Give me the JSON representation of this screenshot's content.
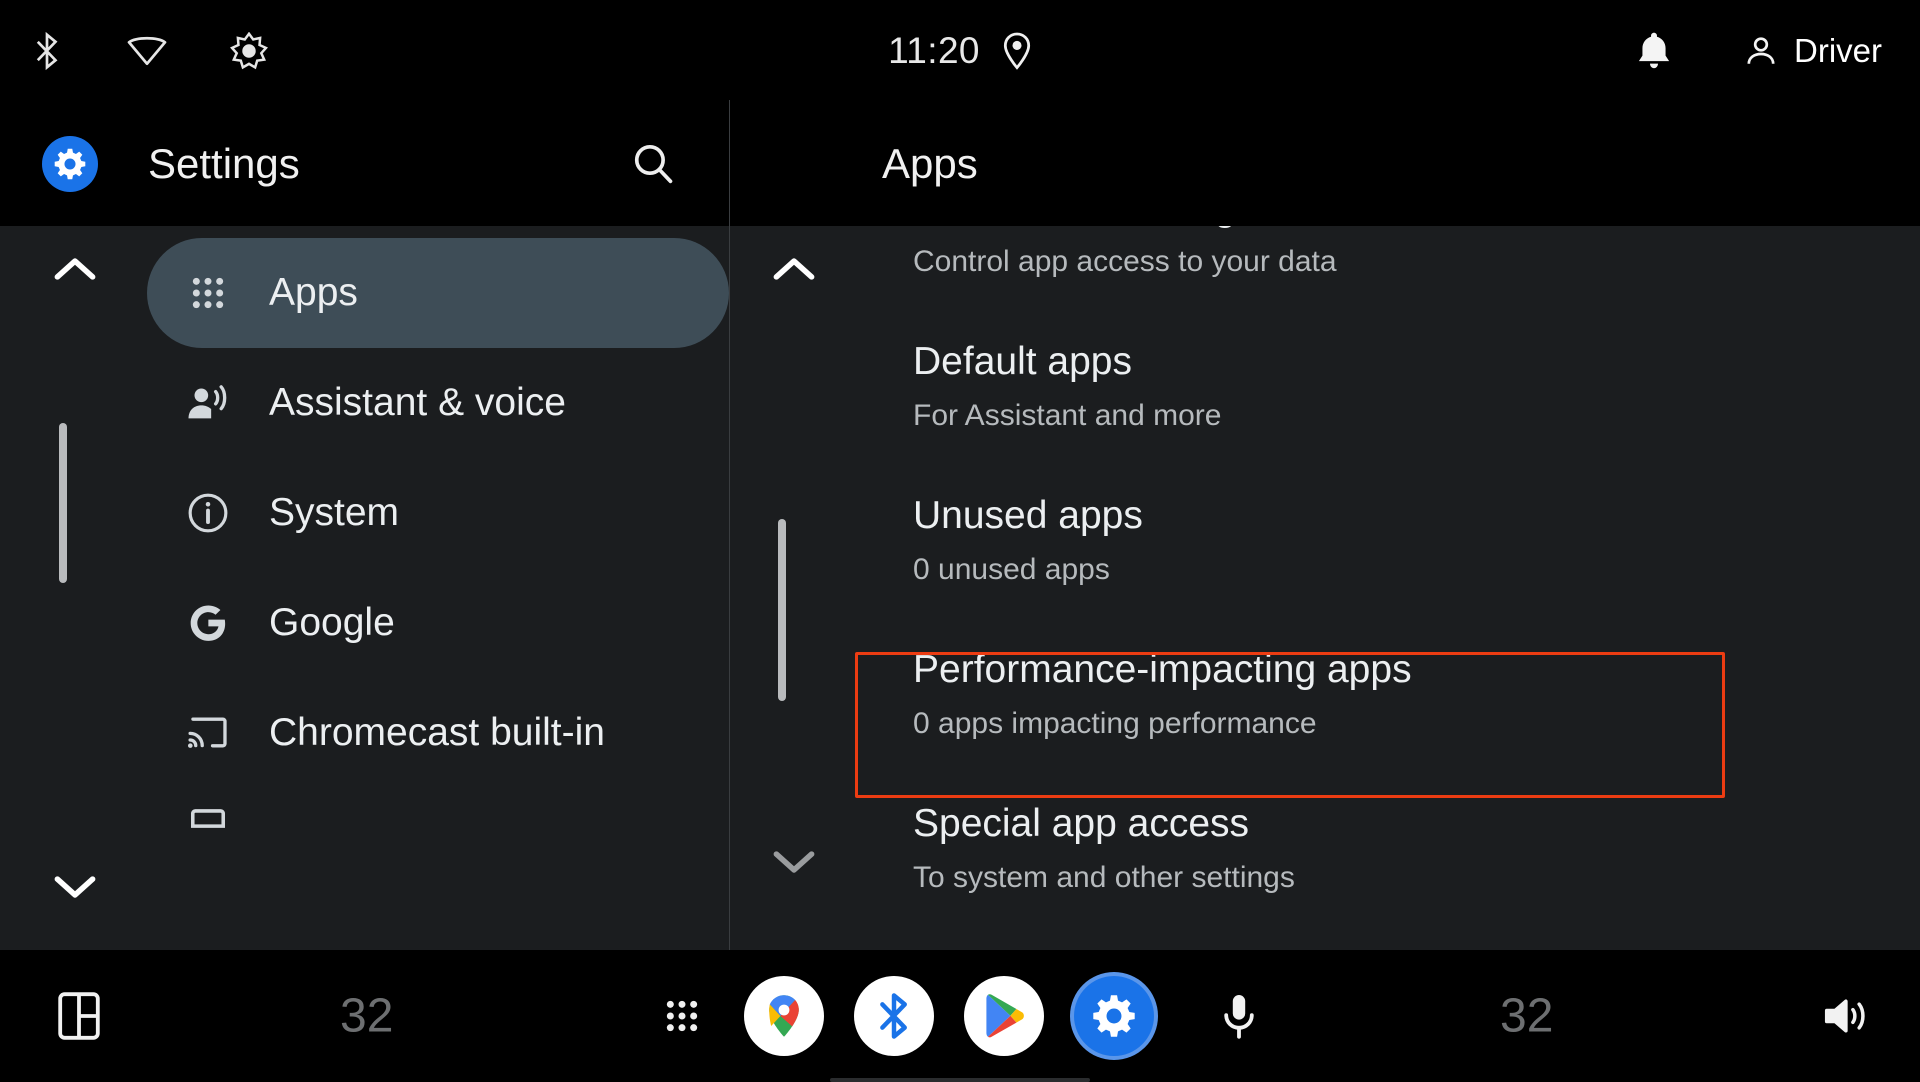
{
  "status_bar": {
    "icons_left": [
      "bluetooth-icon",
      "wifi-icon",
      "brightness-icon"
    ],
    "time": "11:20",
    "location_icon": "location-pin-icon",
    "notification_icon": "bell-icon",
    "user_icon": "person-icon",
    "user_name": "Driver"
  },
  "header": {
    "app_icon": "settings-gear-icon",
    "app_title": "Settings",
    "search_icon": "search-icon",
    "pane_title": "Apps"
  },
  "sidebar": {
    "scroll_up_icon": "chevron-up-icon",
    "scroll_down_icon": "chevron-down-icon",
    "items": [
      {
        "label": "Apps",
        "icon": "apps-grid-icon",
        "selected": true
      },
      {
        "label": "Assistant & voice",
        "icon": "assistant-voice-icon",
        "selected": false
      },
      {
        "label": "System",
        "icon": "info-circle-icon",
        "selected": false
      },
      {
        "label": "Google",
        "icon": "google-g-icon",
        "selected": false
      },
      {
        "label": "Chromecast built-in",
        "icon": "cast-icon",
        "selected": false
      }
    ]
  },
  "content": {
    "scroll_up_icon": "chevron-up-icon",
    "scroll_down_icon": "chevron-down-icon",
    "items": [
      {
        "title": "Permission manager",
        "subtitle": "Control app access to your data",
        "highlighted": false
      },
      {
        "title": "Default apps",
        "subtitle": "For Assistant and more",
        "highlighted": false
      },
      {
        "title": "Unused apps",
        "subtitle": "0 unused apps",
        "highlighted": false
      },
      {
        "title": "Performance-impacting apps",
        "subtitle": "0 apps impacting performance",
        "highlighted": true
      },
      {
        "title": "Special app access",
        "subtitle": "To system and other settings",
        "highlighted": false
      }
    ]
  },
  "nav_bar": {
    "split_screen_icon": "split-screen-icon",
    "temp_left": "32",
    "grid_icon": "apps-grid-icon",
    "apps": [
      {
        "name": "google-maps-icon",
        "label": "Maps"
      },
      {
        "name": "bluetooth-icon",
        "label": "Bluetooth"
      },
      {
        "name": "google-play-icon",
        "label": "Play Store"
      },
      {
        "name": "settings-gear-icon",
        "label": "Settings"
      }
    ],
    "mic_icon": "microphone-icon",
    "temp_right": "32",
    "volume_icon": "volume-up-icon"
  },
  "colors": {
    "accent_blue": "#1a73e8",
    "highlight_red": "#ec3c12",
    "selected_nav_bg": "#3e4d57",
    "pane_bg": "#1b1d1f",
    "bar_bg": "#000000"
  }
}
